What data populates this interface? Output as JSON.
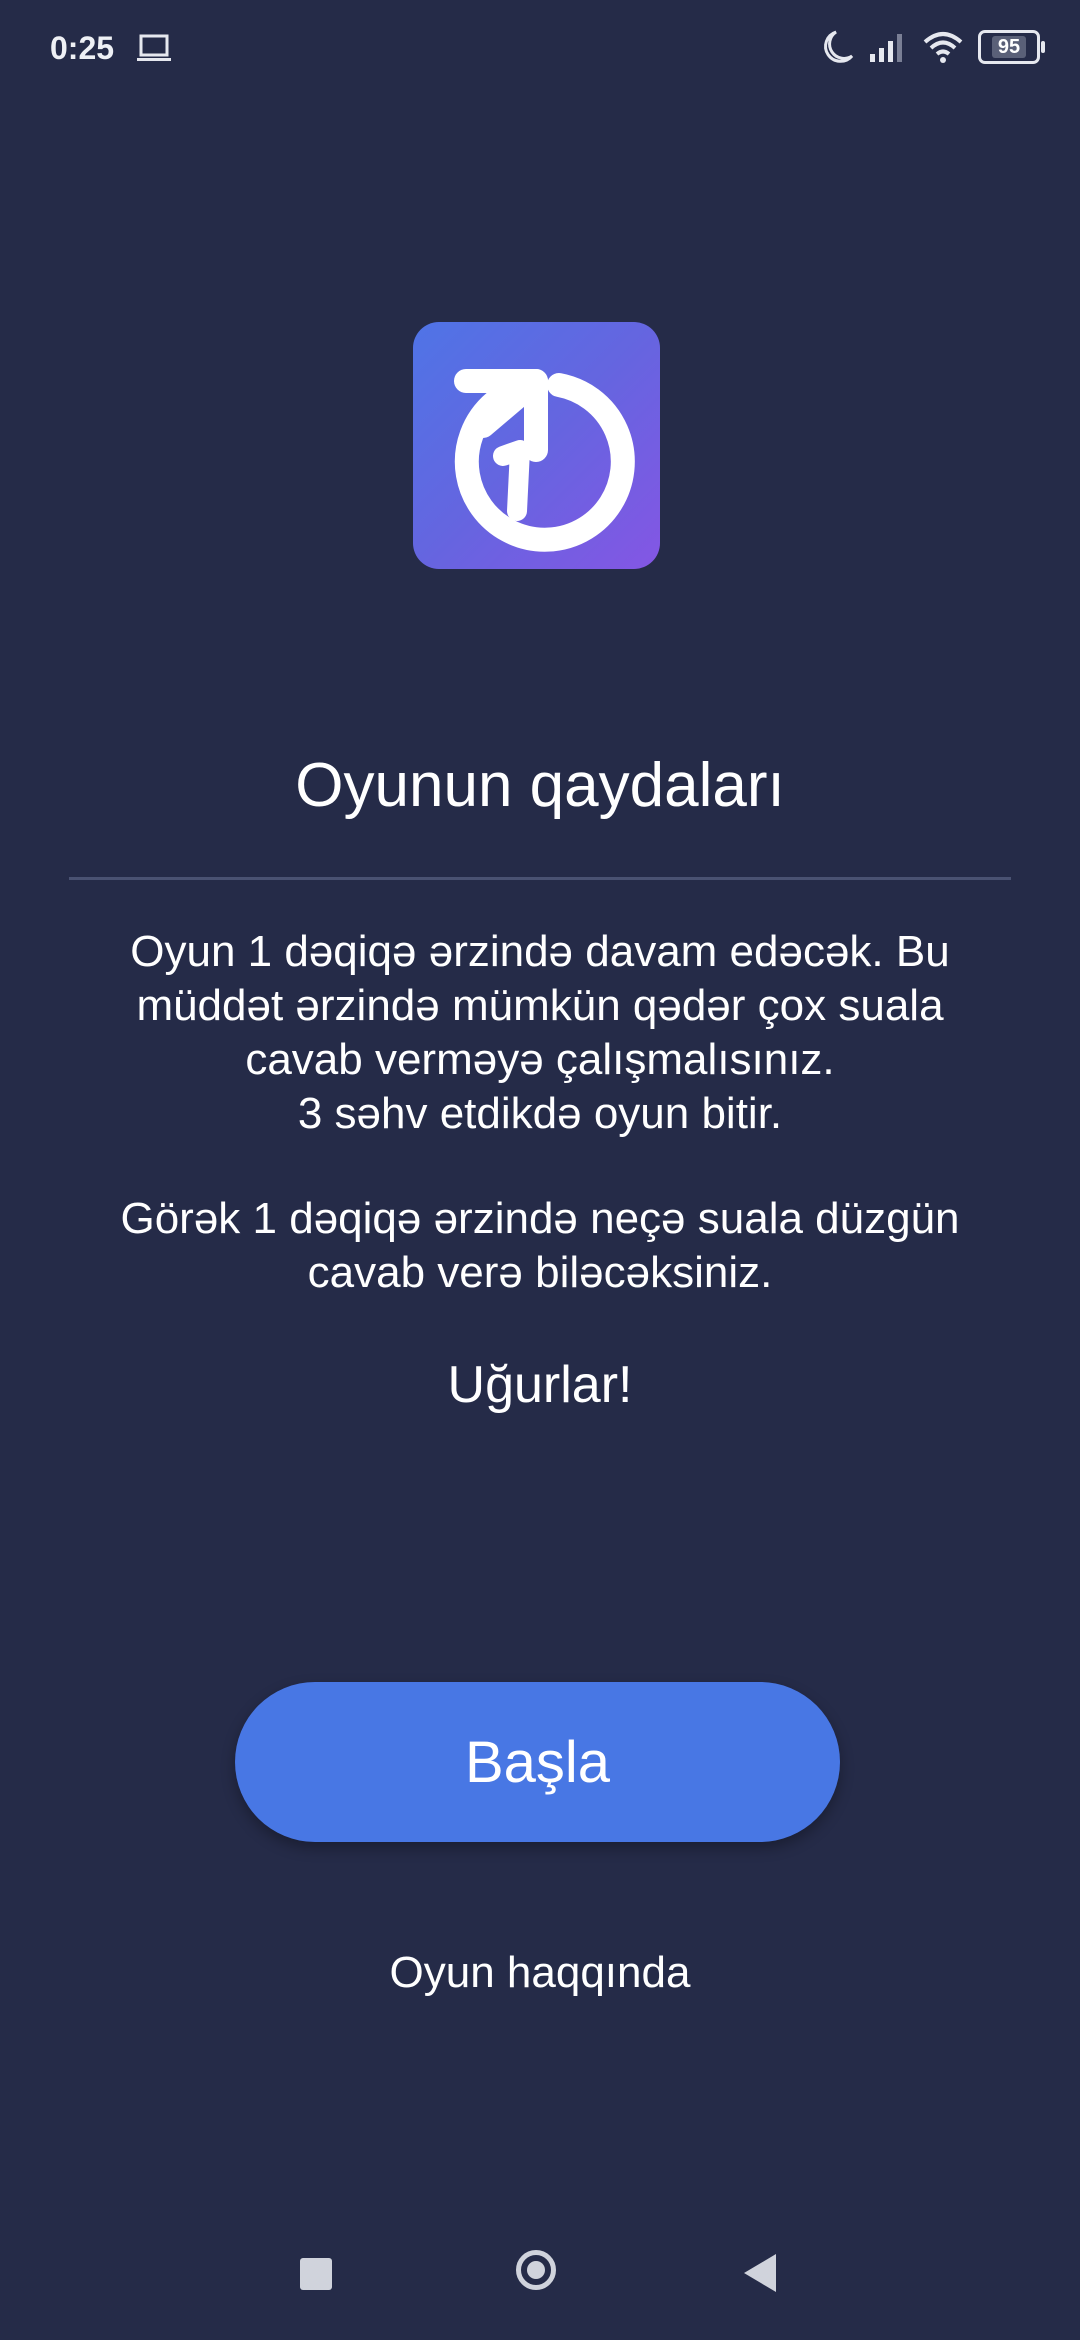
{
  "status_bar": {
    "time": "0:25",
    "battery": "95",
    "icons": [
      "laptop-icon",
      "moon-icon",
      "signal-icon",
      "wifi-icon",
      "battery-icon"
    ]
  },
  "app_icon": {
    "name": "timer-one-icon",
    "text": "1"
  },
  "rules": {
    "title": "Oyunun qaydaları",
    "paragraph1": [
      "Oyun 1 dəqiqə ərzində davam edəcək. Bu",
      "müddət ərzində mümkün qədər çox suala",
      "cavab verməyə çalışmalısınız.",
      "3 səhv etdikdə oyun bitir."
    ],
    "paragraph2": [
      "Görək 1 dəqiqə ərzində neçə suala düzgün",
      "cavab verə biləcəksiniz."
    ],
    "good_luck": "Uğurlar!"
  },
  "actions": {
    "start_label": "Başla",
    "about_label": "Oyun haqqında"
  },
  "colors": {
    "background": "#252b48",
    "button": "#4877e4",
    "icon_gradient_start": "#4f74e6",
    "icon_gradient_end": "#8456e4"
  },
  "nav_bar": {
    "icons": [
      "recents-icon",
      "home-icon",
      "back-icon"
    ]
  }
}
